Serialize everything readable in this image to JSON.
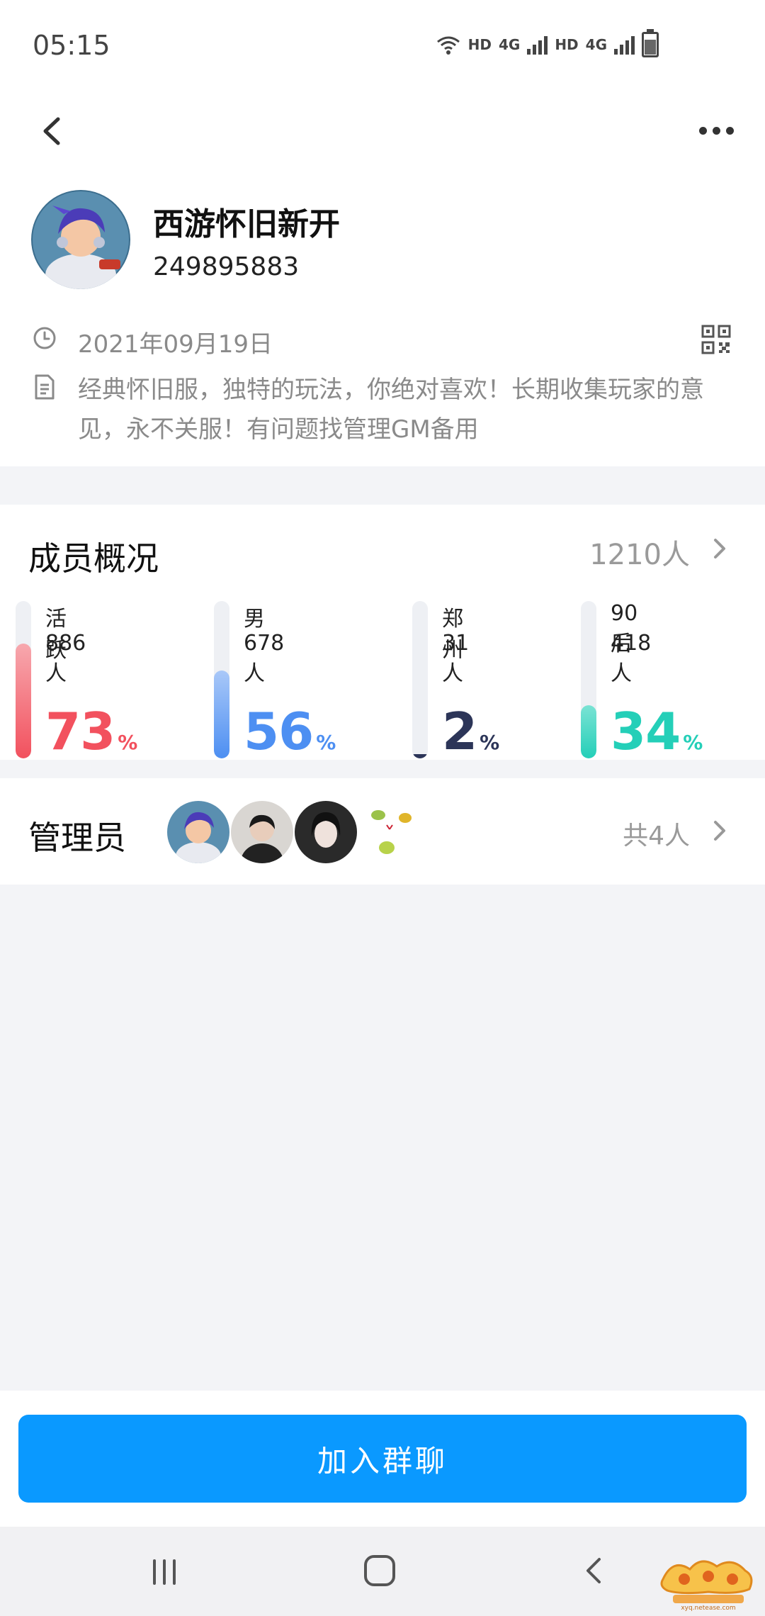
{
  "status_bar": {
    "time": "05:15",
    "hd_label": "HD",
    "net_label": "4G"
  },
  "header": {
    "back_icon": "chevron-left-icon",
    "more_icon": "more-dots-icon"
  },
  "group": {
    "name": "西游怀旧新开",
    "id": "249895883",
    "created_date": "2021年09月19日",
    "description": "经典怀旧服，独特的玩法，你绝对喜欢！长期收集玩家的意见，永不关服！有问题找管理GM备用"
  },
  "overview": {
    "title": "成员概况",
    "total": "1210人",
    "stats": [
      {
        "label": "活跃",
        "count": "886人",
        "percent": 73,
        "percent_text": "73",
        "color": "#f2515e",
        "color_light": "#f7a8ae"
      },
      {
        "label": "男",
        "count": "678人",
        "percent": 56,
        "percent_text": "56",
        "color": "#4d8ff2",
        "color_light": "#a9c8f8"
      },
      {
        "label": "郑州",
        "count": "31人",
        "percent": 2,
        "percent_text": "2",
        "color": "#2c3558",
        "color_light": "#2c3558"
      },
      {
        "label": "90后",
        "count": "418人",
        "percent": 34,
        "percent_text": "34",
        "color": "#24cfb8",
        "color_light": "#7ae3d4"
      }
    ],
    "percent_sign": "%"
  },
  "admins": {
    "title": "管理员",
    "total": "共4人"
  },
  "join_button": "加入群聊",
  "watermark_text": "xyq.netease.com",
  "colors": {
    "accent": "#0a99ff",
    "muted_text": "#8a8a8a",
    "section_bg": "#f3f4f7"
  }
}
